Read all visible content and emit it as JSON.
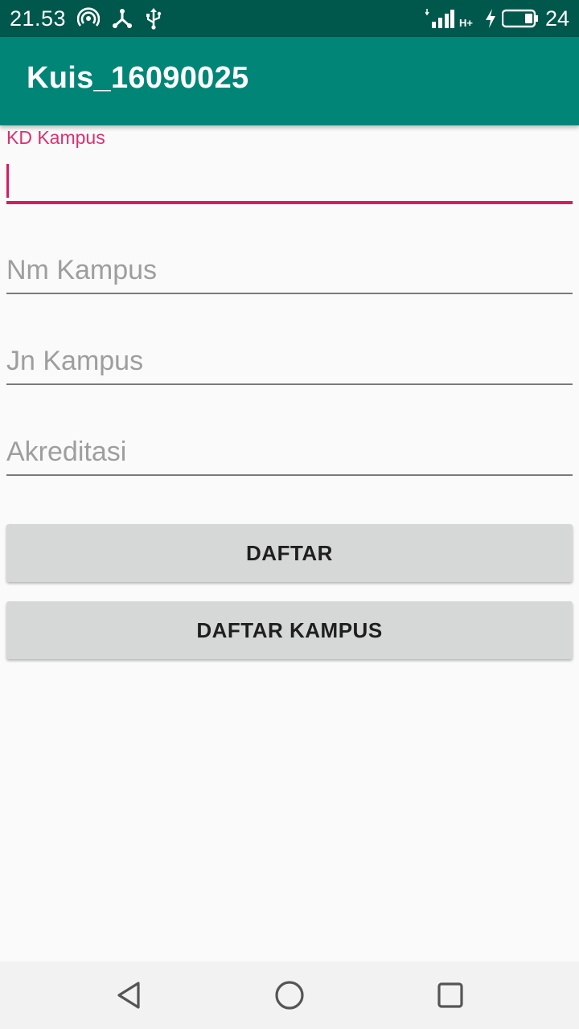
{
  "status_bar": {
    "time": "21.53",
    "battery_percent": "24",
    "network_type": "H+",
    "icons": [
      "hotspot-icon",
      "share-icon",
      "usb-icon",
      "signal-icon",
      "charging-icon",
      "battery-icon"
    ]
  },
  "app_bar": {
    "title": "Kuis_16090025",
    "color": "#008577"
  },
  "form": {
    "kd_kampus": {
      "label": "KD Kampus",
      "value": ""
    },
    "nm_kampus": {
      "placeholder": "Nm Kampus",
      "value": ""
    },
    "jn_kampus": {
      "placeholder": "Jn Kampus",
      "value": ""
    },
    "akreditasi": {
      "placeholder": "Akreditasi",
      "value": ""
    },
    "accent_color": "#d81b60"
  },
  "buttons": {
    "daftar": "DAFTAR",
    "daftar_kampus": "DAFTAR KAMPUS"
  },
  "nav_bar": {
    "icons": [
      "back-icon",
      "home-icon",
      "recents-icon"
    ]
  }
}
